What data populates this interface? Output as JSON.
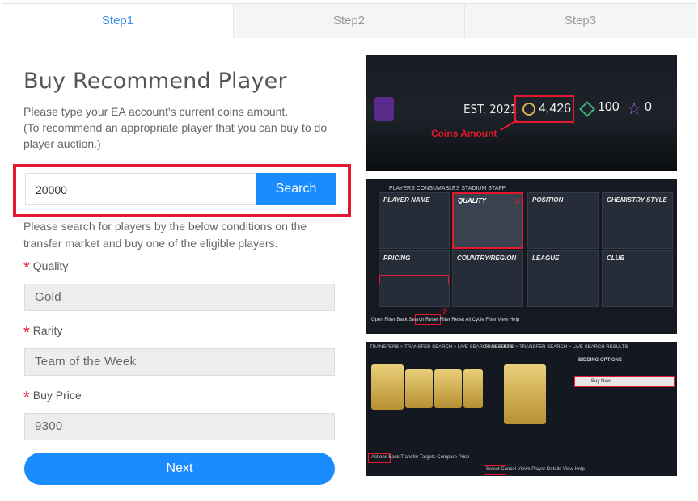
{
  "tabs": [
    {
      "label": "Step1",
      "active": true
    },
    {
      "label": "Step2",
      "active": false
    },
    {
      "label": "Step3",
      "active": false
    }
  ],
  "title": "Buy Recommend Player",
  "description_line1": "Please type your EA account's current coins amount.",
  "description_line2": "(To recommend an appropriate player that you can buy to do player auction.)",
  "search": {
    "value": "20000",
    "button_label": "Search"
  },
  "conditions_text": "Please search for players by the below conditions on the transfer market and buy one of the eligible players.",
  "fields": {
    "quality": {
      "label": "Quality",
      "value": "Gold"
    },
    "rarity": {
      "label": "Rarity",
      "value": "Team of the Week"
    },
    "buy_price": {
      "label": "Buy Price",
      "value": "9300"
    }
  },
  "next_label": "Next",
  "screenshot1": {
    "est": "EST. 2021",
    "coins": "4,426",
    "points": "100",
    "stars": "0",
    "coins_label": "Coins Amount"
  },
  "screenshot2": {
    "tabs": "PLAYERS   CONSUMABLES   STADIUM   STAFF",
    "cells": [
      "PLAYER NAME",
      "QUALITY",
      "POSITION",
      "CHEMISTRY STYLE",
      "PRICING",
      "COUNTRY/REGION",
      "LEAGUE",
      "CLUB"
    ],
    "markers": [
      "①",
      "②",
      "③"
    ],
    "bottom": "Open Filter   Back   Search   Reset Filter   Reset All   Cycle Filter   View Help"
  },
  "screenshot3": {
    "left_header": "TRANSFERS > TRANSFER SEARCH > LIVE SEARCH RESULTS",
    "right_header": "TRANSFERS > TRANSFER SEARCH > LIVE SEARCH RESULTS",
    "bidding": "BIDDING OPTIONS",
    "buy_now": "Buy Now",
    "bottom_left": "Actions   Back   Transfer Targets   Compare Price",
    "bottom_right": "Select   Cancel   Views   Player Details   View Help"
  },
  "colors": {
    "accent": "#1a8cff",
    "highlight": "#e5182e",
    "tab_active": "#3a8ee6"
  }
}
